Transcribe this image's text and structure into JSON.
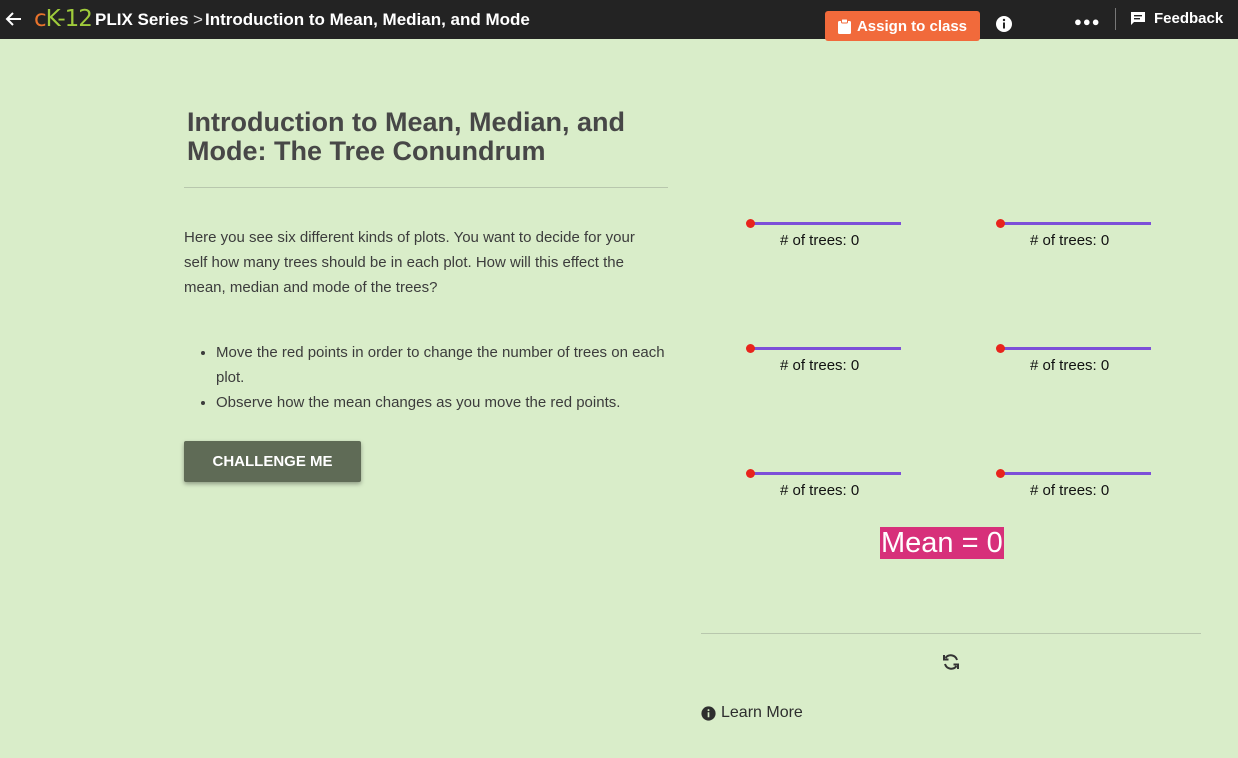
{
  "topbar": {
    "logo": {
      "c": "c",
      "k": "K",
      "num": "-12"
    },
    "series_label": "PLIX Series",
    "separator": ">",
    "page_title": "Introduction to Mean, Median, and Mode",
    "assign_label": "Assign to class",
    "more_label": "●●●",
    "feedback_label": "Feedback"
  },
  "content": {
    "title": "Introduction to Mean, Median, and Mode: The Tree Conundrum",
    "intro": "Here you see six different kinds of plots. You want to decide for your self how many trees should be in each plot. How will this effect the mean, median and mode of the trees?",
    "bullets": [
      "Move the red points in order to change the number of trees on each plot.",
      "Observe how the mean changes as you move the red points."
    ],
    "challenge_label": "CHALLENGE ME"
  },
  "interactive": {
    "plots": [
      {
        "label": "# of trees: 0",
        "value": 0
      },
      {
        "label": "# of trees: 0",
        "value": 0
      },
      {
        "label": "# of trees: 0",
        "value": 0
      },
      {
        "label": "# of trees: 0",
        "value": 0
      },
      {
        "label": "# of trees: 0",
        "value": 0
      },
      {
        "label": "# of trees: 0",
        "value": 0
      }
    ],
    "mean_label": "Mean = 0",
    "learn_more_label": "Learn More"
  },
  "colors": {
    "background": "#d9edc9",
    "topbar": "#232323",
    "assign_button": "#f16a3b",
    "challenge_button": "#5f6b56",
    "slider_track": "#7d4fd8",
    "slider_knob": "#e8241c",
    "mean_highlight": "#d7307a"
  }
}
